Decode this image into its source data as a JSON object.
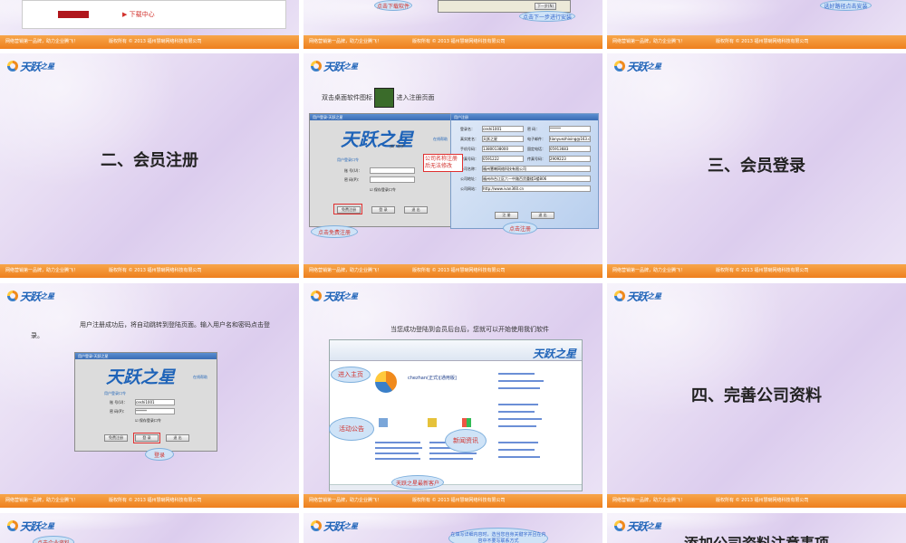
{
  "footer": {
    "slogan": "网络营销第一品牌，助力企业腾飞！",
    "copyright": "版权所有 © 2013 福州慧喇网络科技有限公司"
  },
  "logo": {
    "brand": "天跃",
    "suffix": "之星"
  },
  "slides": {
    "s1": {
      "menu_item": "下载中心"
    },
    "s2": {
      "bubble_download": "点击下载软件",
      "bubble_next": "点击下一步进行安装",
      "btn_next": "下一步(N)"
    },
    "s3": {
      "bubble_path": "选好路径点击安装"
    },
    "s4": {
      "title": "二、会员注册"
    },
    "s5": {
      "instruction_pre": "双击桌面软件图标",
      "instruction_post": "进入注册页面",
      "login_window_title": "用户登录-天跃之星",
      "login_brand": "天跃之星",
      "login_sub": "推广助手",
      "help_link": "在线帮助",
      "login_section": "用户登录口令",
      "account_label": "账 号(U)：",
      "password_label": "密 码(P)：",
      "remember": "保存登录口令",
      "btn_register": "免费注册",
      "btn_login": "登 录",
      "btn_exit": "退 出",
      "bubble_register": "点击免费注册",
      "note_company": "公司名称注册后无法修改",
      "reg_window_title": "用户注册",
      "reg_fields": [
        {
          "label": "登录名：",
          "value": "ceshi1001"
        },
        {
          "label": "密 码：",
          "value": "******"
        },
        {
          "label": "真实姓名：",
          "value": "天跃之星"
        },
        {
          "label": "电子邮件：",
          "value": "tianyuezhixing@163.com"
        },
        {
          "label": "手机号码：",
          "value": "13800138000"
        },
        {
          "label": "固定电话：",
          "value": "05913683"
        },
        {
          "label": "传真号码：",
          "value": "0591222"
        },
        {
          "label": "传真号码：",
          "value": "2909223"
        },
        {
          "label": "公司名称：",
          "value": "福州慧喇网络科技有限公司"
        },
        {
          "label": "公司地址：",
          "value": "福州市台江区六一中路百货重楼3楼806"
        },
        {
          "label": "公司网站：",
          "value": "http://www.ivan360.cn"
        }
      ],
      "reg_btn_register": "注 册",
      "reg_btn_exit": "退 出",
      "bubble_click_register": "点击注册"
    },
    "s6": {
      "title": "三、会员登录"
    },
    "s7": {
      "instruction": "用户注册成功后，将自动跳转到登陆页面。输入用户名和密码点击登录。",
      "login_window_title": "用户登录-天跃之星",
      "account_value": "ceshi1001",
      "password_value": "******",
      "bubble_login": "登录"
    },
    "s8": {
      "instruction": "当您成功登陆到会员后台后，您就可以开始使用我们软件",
      "bubble_home": "进入主页",
      "bubble_notice": "活动公告",
      "bubble_news": "新闻资讯",
      "bubble_customer": "天跃之星最新客户",
      "username": "chezhan(正式)[通用版]",
      "app_brand": "天跃之星"
    },
    "s9": {
      "title": "四、完善公司资料"
    },
    "s10": {
      "bubble_info": "点击企业资料"
    },
    "s11": {
      "bubble_note": "在填写详细内容时，选当您自身关键字并且在内容中不要写联系方式"
    },
    "s12": {
      "title": "添加公司资料注意事项"
    }
  },
  "colors": {
    "footer": "#ee7f1e",
    "brand_blue": "#1e63b8",
    "callout_red": "#d2322d"
  }
}
